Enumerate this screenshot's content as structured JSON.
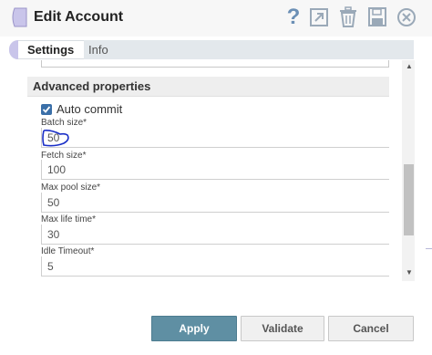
{
  "header": {
    "title": "Edit Account",
    "icons": [
      "help-icon",
      "export-icon",
      "delete-icon",
      "save-icon",
      "close-icon"
    ],
    "help_glyph": "?"
  },
  "tabs": [
    {
      "label": "Settings",
      "active": true
    },
    {
      "label": "Info",
      "active": false
    }
  ],
  "section": {
    "title": "Advanced properties"
  },
  "auto_commit": {
    "label": "Auto commit",
    "checked": true
  },
  "fields": [
    {
      "label": "Batch size*",
      "value": "50"
    },
    {
      "label": "Fetch size*",
      "value": "100"
    },
    {
      "label": "Max pool size*",
      "value": "50"
    },
    {
      "label": "Max life time*",
      "value": "30"
    },
    {
      "label": "Idle Timeout*",
      "value": "5"
    }
  ],
  "buttons": {
    "apply": "Apply",
    "validate": "Validate",
    "cancel": "Cancel"
  },
  "colors": {
    "accent": "#5f8fa3",
    "checkbox": "#3a6fa8",
    "logo": "#c9c5ea",
    "annotation": "#1a2fc7"
  }
}
